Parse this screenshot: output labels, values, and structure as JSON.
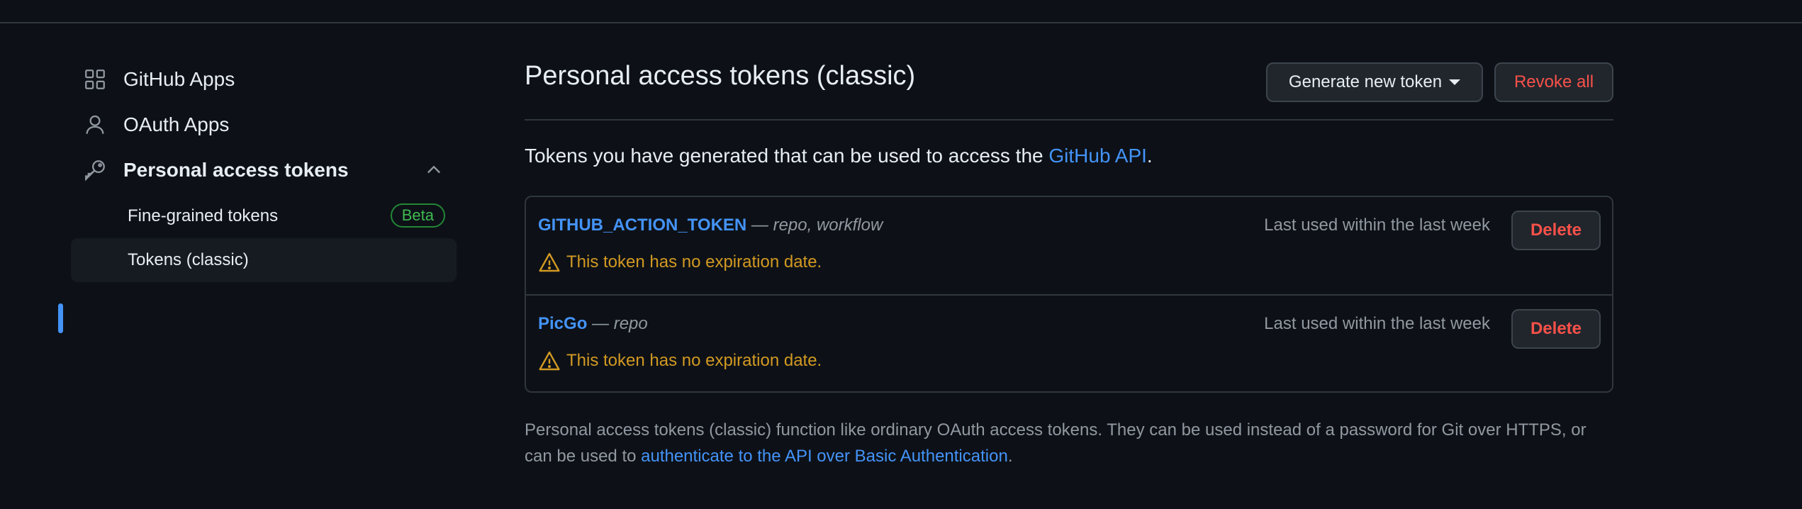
{
  "sidebar": {
    "items": [
      {
        "label": "GitHub Apps",
        "icon": "apps-grid-icon"
      },
      {
        "label": "OAuth Apps",
        "icon": "person-icon"
      },
      {
        "label": "Personal access tokens",
        "icon": "key-icon"
      }
    ],
    "sub_items": [
      {
        "label": "Fine-grained tokens",
        "badge": "Beta"
      },
      {
        "label": "Tokens (classic)",
        "active": true
      }
    ]
  },
  "main": {
    "title": "Personal access tokens (classic)",
    "generate_label": "Generate new token",
    "revoke_label": "Revoke all",
    "intro_text": "Tokens you have generated that can be used to access the ",
    "intro_link": "GitHub API",
    "intro_end": ".",
    "tokens": [
      {
        "name": "GITHUB_ACTION_TOKEN",
        "scopes": " — repo, workflow",
        "last_used": "Last used within the last week",
        "warning": "This token has no expiration date.",
        "delete_label": "Delete"
      },
      {
        "name": "PicGo",
        "scopes": " — repo",
        "last_used": "Last used within the last week",
        "warning": "This token has no expiration date.",
        "delete_label": "Delete"
      }
    ],
    "footer_text": "Personal access tokens (classic) function like ordinary OAuth access tokens. They can be used instead of a password for Git over HTTPS, or can be used to ",
    "footer_link": "authenticate to the API over Basic Authentication",
    "footer_end": "."
  },
  "colors": {
    "background": "#0d1117",
    "accent": "#4493f8",
    "danger": "#f85149",
    "warning": "#d29922",
    "success": "#3fb950"
  }
}
